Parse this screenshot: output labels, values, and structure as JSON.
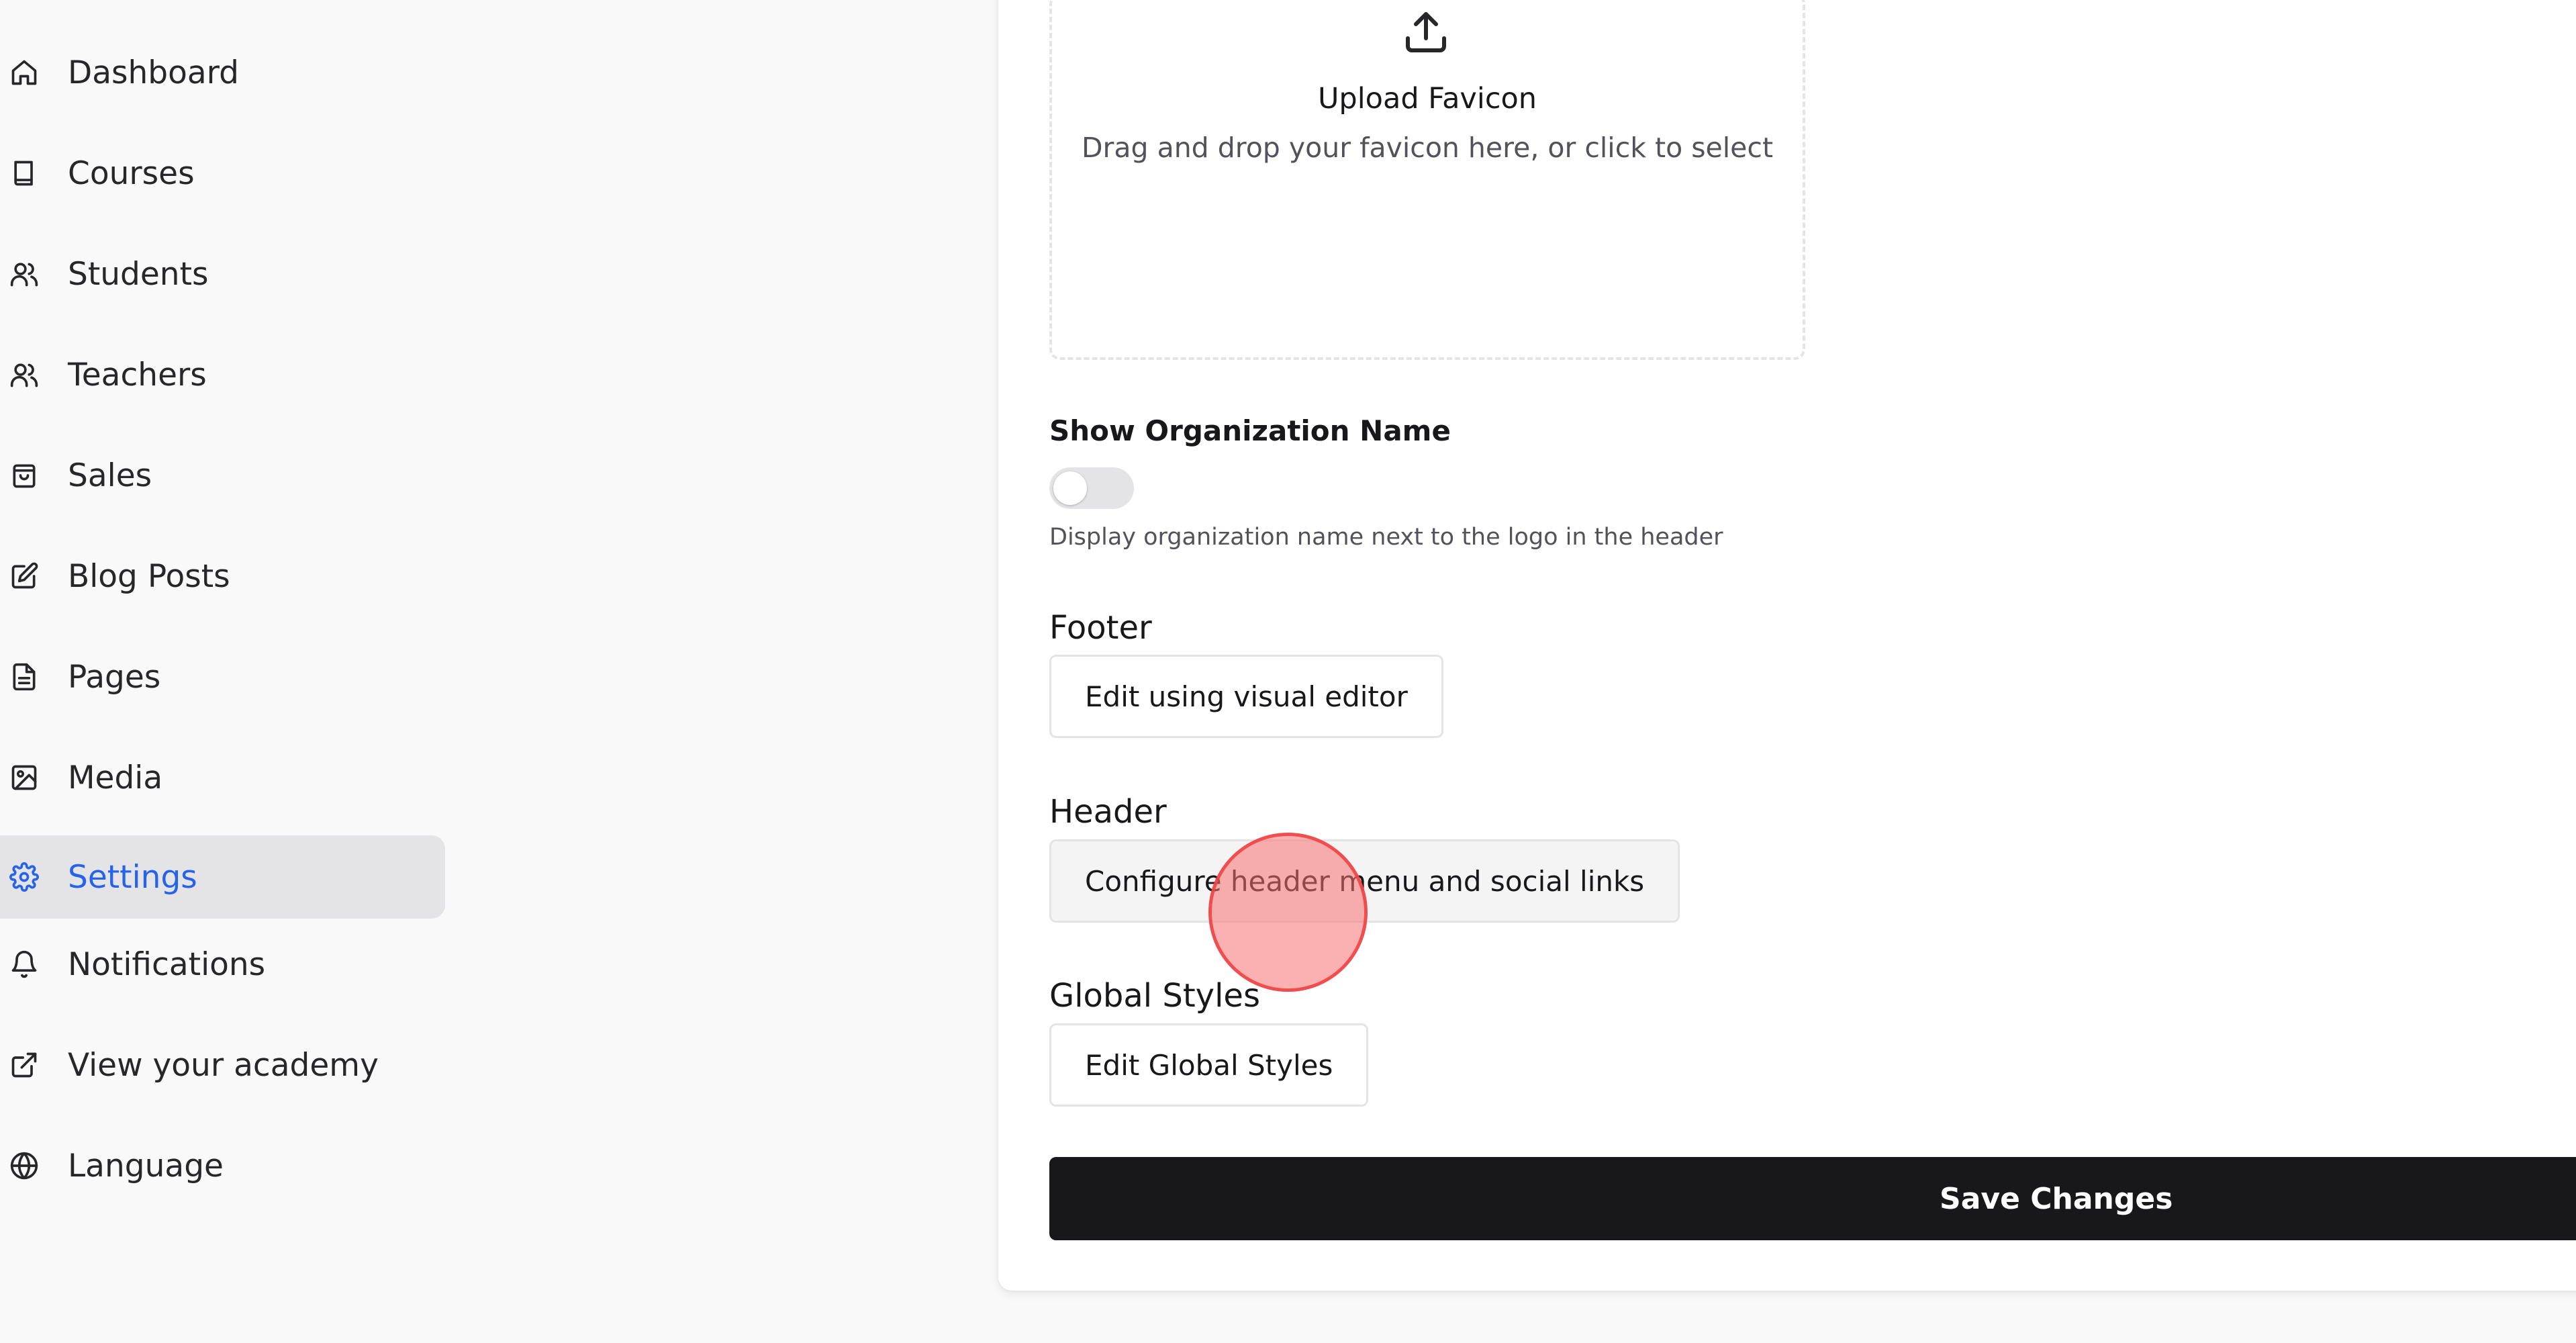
{
  "sidebar": {
    "items": [
      {
        "label": "Dashboard",
        "icon": "home-icon"
      },
      {
        "label": "Courses",
        "icon": "book-icon"
      },
      {
        "label": "Students",
        "icon": "users-icon"
      },
      {
        "label": "Teachers",
        "icon": "users-icon"
      },
      {
        "label": "Sales",
        "icon": "shopping-bag-icon"
      },
      {
        "label": "Blog Posts",
        "icon": "edit-icon"
      },
      {
        "label": "Pages",
        "icon": "file-text-icon"
      },
      {
        "label": "Media",
        "icon": "image-icon"
      },
      {
        "label": "Settings",
        "icon": "gear-icon",
        "active": true
      },
      {
        "label": "Notifications",
        "icon": "bell-icon"
      },
      {
        "label": "View your academy",
        "icon": "external-link-icon"
      },
      {
        "label": "Language",
        "icon": "globe-icon"
      }
    ]
  },
  "favicon": {
    "title": "Upload Favicon",
    "subtitle": "Drag and drop your favicon here, or click to select"
  },
  "org_name": {
    "label": "Show Organization Name",
    "enabled": false,
    "help": "Display organization name next to the logo in the header"
  },
  "footer": {
    "label": "Footer",
    "button": "Edit using visual editor"
  },
  "header": {
    "label": "Header",
    "button": "Configure header menu and social links"
  },
  "global_styles": {
    "label": "Global Styles",
    "button": "Edit Global Styles"
  },
  "save_label": "Save Changes",
  "colors": {
    "accent": "#2563eb",
    "primary_button": "#18181b",
    "active_bg": "#e4e4e7"
  }
}
